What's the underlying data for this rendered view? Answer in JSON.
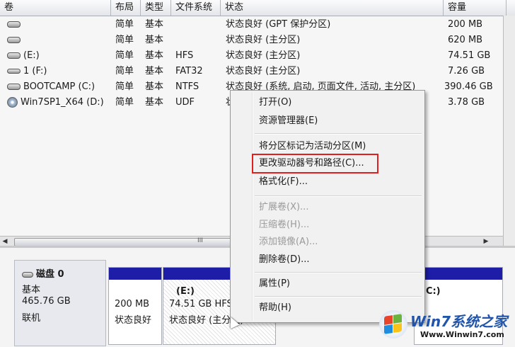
{
  "columns": [
    "卷",
    "布局",
    "类型",
    "文件系统",
    "状态",
    "容量"
  ],
  "volumes": [
    {
      "name": "",
      "icon": "disk-icon",
      "layout": "简单",
      "type": "基本",
      "fs": "",
      "status": "状态良好 (GPT 保护分区)",
      "capacity": "200 MB",
      "overflow": "2"
    },
    {
      "name": "",
      "icon": "disk-icon",
      "layout": "简单",
      "type": "基本",
      "fs": "",
      "status": "状态良好 (主分区)",
      "capacity": "620 MB",
      "overflow": "6"
    },
    {
      "name": "(E:)",
      "icon": "disk-icon",
      "layout": "简单",
      "type": "基本",
      "fs": "HFS",
      "status": "状态良好 (主分区)",
      "capacity": "74.51 GB",
      "overflow": "1"
    },
    {
      "name": "1 (F:)",
      "icon": "removable-disk-icon",
      "layout": "简单",
      "type": "基本",
      "fs": "FAT32",
      "status": "状态良好 (主分区)",
      "capacity": "7.26 GB",
      "overflow": "5"
    },
    {
      "name": "BOOTCAMP (C:)",
      "icon": "disk-icon",
      "layout": "简单",
      "type": "基本",
      "fs": "NTFS",
      "status": "状态良好 (系统, 启动, 页面文件, 活动, 主分区)",
      "capacity": "390.46 GB",
      "overflow": "1"
    },
    {
      "name": "Win7SP1_X64 (D:)",
      "icon": "cd-icon",
      "layout": "简单",
      "type": "基本",
      "fs": "UDF",
      "status": "状",
      "capacity": "3.78 GB",
      "overflow": ""
    }
  ],
  "disk": {
    "title": "磁盘 0",
    "type": "基本",
    "size": "465.76 GB",
    "status": "联机"
  },
  "partitions": [
    {
      "name": "",
      "size": "200 MB",
      "status": "状态良好"
    },
    {
      "name": "(E:)",
      "size": "74.51 GB HFS",
      "status": "状态良好 (主分区)"
    },
    {
      "name": "(C:)",
      "size": "",
      "status": ""
    }
  ],
  "scroll_center": "III",
  "context_menu": [
    {
      "label": "打开(O)",
      "enabled": true
    },
    {
      "label": "资源管理器(E)",
      "enabled": true
    },
    {
      "separator": true
    },
    {
      "label": "将分区标记为活动分区(M)",
      "enabled": true
    },
    {
      "label": "更改驱动器号和路径(C)...",
      "enabled": true,
      "highlighted": true
    },
    {
      "label": "格式化(F)...",
      "enabled": true
    },
    {
      "separator": true
    },
    {
      "label": "扩展卷(X)...",
      "enabled": false
    },
    {
      "label": "压缩卷(H)...",
      "enabled": false
    },
    {
      "label": "添加镜像(A)...",
      "enabled": false
    },
    {
      "label": "删除卷(D)...",
      "enabled": true
    },
    {
      "separator": true
    },
    {
      "label": "属性(P)",
      "enabled": true
    },
    {
      "separator": true
    },
    {
      "label": "帮助(H)",
      "enabled": true
    }
  ],
  "watermark": {
    "site": "Win7系统之家",
    "url": "Www.Winwin7.com"
  },
  "colors": {
    "highlight_box": "#e02020",
    "partition_bar": "#1d1da8"
  }
}
